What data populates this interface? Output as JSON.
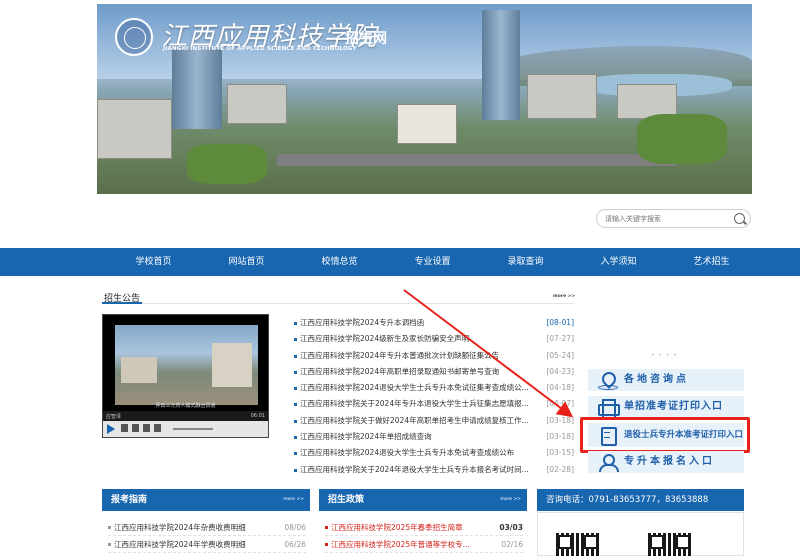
{
  "banner": {
    "school_name_cn": "江西应用科技学院",
    "school_name_en": "JIANGXI INSTITUTE OF APPLIED SCIENCE AND TECHNOLOGY",
    "site_name": "招生网"
  },
  "search": {
    "placeholder": "请输入关键字搜索"
  },
  "nav": {
    "items": [
      "学校首页",
      "网站首页",
      "校情总览",
      "专业设置",
      "录取查询",
      "入学须知",
      "艺术招生"
    ]
  },
  "news": {
    "title": "招生公告",
    "more": "more >>",
    "items": [
      {
        "title": "江西应用科技学院2024专升本调档函",
        "date": "[08-01]"
      },
      {
        "title": "江西应用科技学院2024级新生及家长防骗安全声明",
        "date": "[07-27]"
      },
      {
        "title": "江西应用科技学院2024年专升本普通批次计划缺额征集公告",
        "date": "[05-24]"
      },
      {
        "title": "江西应用科技学院2024年高职单招录取通知书邮寄单号查询",
        "date": "[04-23]"
      },
      {
        "title": "江西应用科技学院2024退役大学生士兵专升本免试征集考查成绩公...",
        "date": "[04-18]"
      },
      {
        "title": "江西应用科技学院关于2024年专升本退役大学生士兵征集志愿填报...",
        "date": "[04-07]"
      },
      {
        "title": "江西应用科技学院关于做好2024年高职单招考生申请成绩复核工作...",
        "date": "[03-18]"
      },
      {
        "title": "江西应用科技学院2024年单招成绩查询",
        "date": "[03-18]"
      },
      {
        "title": "江西应用科技学院2024退役大学生士兵专升本免试考查成绩公布",
        "date": "[03-15]"
      },
      {
        "title": "江西应用科技学院关于2024年退役大学生士兵专升本报名考试时间...",
        "date": "[02-28]"
      }
    ]
  },
  "video": {
    "caption": "弄田三元育人模式融合贯通",
    "source": "应智泽",
    "time": "06:01"
  },
  "dots": "• • • •",
  "side_buttons": [
    {
      "label": "各地咨询点",
      "icon": "location-pin-icon"
    },
    {
      "label": "单招准考证打印入口",
      "icon": "printer-icon"
    },
    {
      "label": "退役士兵专升本准考证打印入口",
      "icon": "document-icon"
    },
    {
      "label": "专升本报名入口",
      "icon": "user-icon"
    }
  ],
  "panels": {
    "guide": {
      "title": "报考指南",
      "more": "more >>",
      "items": [
        {
          "title": "江西应用科技学院2024年杂费收费明细",
          "date": "08/06"
        },
        {
          "title": "江西应用科技学院2024年学费收费明细",
          "date": "06/26"
        }
      ]
    },
    "policy": {
      "title": "招生政策",
      "more": "more >>",
      "items": [
        {
          "title": "江西应用科技学院2025年春季招生简章",
          "date": "03/03"
        },
        {
          "title": "江西应用科技学院2025年普通等学校专...",
          "date": "02/16"
        }
      ]
    },
    "contact": {
      "label": "咨询电话：0791-83653777，83653888"
    }
  },
  "colors": {
    "primary_blue": "#1865b0",
    "highlight_red": "#e8211a",
    "button_bg": "#e7f1fa"
  }
}
